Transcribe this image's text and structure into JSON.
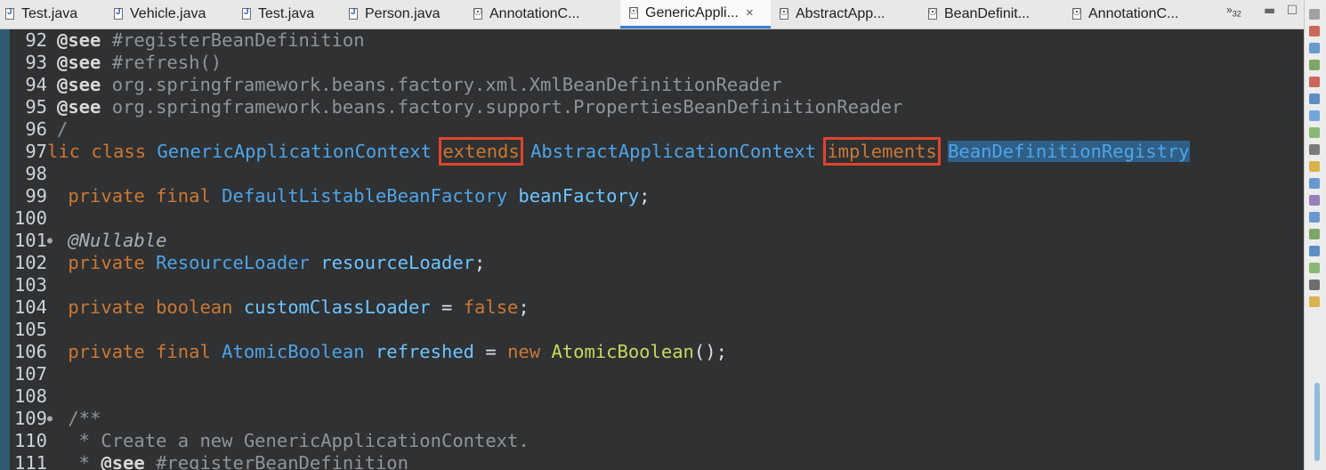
{
  "tabs": [
    {
      "label": "Test.java",
      "icon": "java-file-icon"
    },
    {
      "label": "Vehicle.java",
      "icon": "java-file-icon"
    },
    {
      "label": "Test.java",
      "icon": "java-file-icon"
    },
    {
      "label": "Person.java",
      "icon": "java-file-icon"
    },
    {
      "label": "AnnotationC...",
      "icon": "class-file-icon"
    },
    {
      "label": "GenericAppli...",
      "icon": "class-file-icon",
      "active": true
    },
    {
      "label": "AbstractApp...",
      "icon": "class-file-icon"
    },
    {
      "label": "BeanDefinit...",
      "icon": "class-file-icon"
    },
    {
      "label": "AnnotationC...",
      "icon": "class-file-icon"
    }
  ],
  "tab_close": "×",
  "overflow_count": "32",
  "window_controls": {
    "minimize": "☐",
    "maximize": "☐"
  },
  "editor": {
    "lines": [
      {
        "num": "92",
        "tokens": [
          [
            "d",
            "@see"
          ],
          [
            "c",
            " #registerBeanDefinition"
          ]
        ]
      },
      {
        "num": "93",
        "tokens": [
          [
            "d",
            "@see"
          ],
          [
            "c",
            " #refresh()"
          ]
        ]
      },
      {
        "num": "94",
        "tokens": [
          [
            "d",
            "@see"
          ],
          [
            "c",
            " org.springframework.beans.factory.xml.XmlBeanDefinitionReader"
          ]
        ]
      },
      {
        "num": "95",
        "tokens": [
          [
            "d",
            "@see"
          ],
          [
            "c",
            " org.springframework.beans.factory.support.PropertiesBeanDefinitionReader"
          ]
        ]
      },
      {
        "num": "96",
        "tokens": [
          [
            "c",
            "/"
          ]
        ]
      },
      {
        "num": "97",
        "tokens": [
          [
            "k",
            "lic class "
          ],
          [
            "t",
            "GenericApplicationContext"
          ],
          [
            "p",
            " "
          ],
          [
            "khl",
            "extends"
          ],
          [
            "p",
            " "
          ],
          [
            "t",
            "AbstractApplicationContext"
          ],
          [
            "p",
            " "
          ],
          [
            "khl",
            "implements"
          ],
          [
            "p",
            " "
          ],
          [
            "tsel",
            "BeanDefinitionRegistry"
          ]
        ]
      },
      {
        "num": "98",
        "tokens": []
      },
      {
        "num": "99",
        "tokens": [
          [
            "k",
            " private final "
          ],
          [
            "t",
            "DefaultListableBeanFactory"
          ],
          [
            "p",
            " "
          ],
          [
            "f",
            "beanFactory"
          ],
          [
            "p",
            ";"
          ]
        ]
      },
      {
        "num": "100",
        "tokens": []
      },
      {
        "num": "101",
        "fold": true,
        "tokens": [
          [
            "a",
            " @Nullable"
          ]
        ]
      },
      {
        "num": "102",
        "tokens": [
          [
            "k",
            " private "
          ],
          [
            "t",
            "ResourceLoader"
          ],
          [
            "p",
            " "
          ],
          [
            "f",
            "resourceLoader"
          ],
          [
            "p",
            ";"
          ]
        ]
      },
      {
        "num": "103",
        "tokens": []
      },
      {
        "num": "104",
        "tokens": [
          [
            "k",
            " private boolean "
          ],
          [
            "f",
            "customClassLoader"
          ],
          [
            "p",
            " = "
          ],
          [
            "k",
            "false"
          ],
          [
            "p",
            ";"
          ]
        ]
      },
      {
        "num": "105",
        "tokens": []
      },
      {
        "num": "106",
        "tokens": [
          [
            "k",
            " private final "
          ],
          [
            "t",
            "AtomicBoolean"
          ],
          [
            "p",
            " "
          ],
          [
            "f",
            "refreshed"
          ],
          [
            "p",
            " = "
          ],
          [
            "k",
            "new "
          ],
          [
            "m",
            "AtomicBoolean"
          ],
          [
            "p",
            "();"
          ]
        ]
      },
      {
        "num": "107",
        "tokens": []
      },
      {
        "num": "108",
        "tokens": []
      },
      {
        "num": "109",
        "fold": true,
        "tokens": [
          [
            "c",
            " /**"
          ]
        ]
      },
      {
        "num": "110",
        "tokens": [
          [
            "c",
            "  * Create a new GenericApplicationContext."
          ]
        ]
      },
      {
        "num": "111",
        "tokens": [
          [
            "c",
            "  * "
          ],
          [
            "d",
            "@see"
          ],
          [
            "c",
            " #registerBeanDefinition"
          ]
        ]
      }
    ]
  },
  "colors": {
    "editor_bg": "#2f3133",
    "keyword": "#cc7832",
    "type": "#4fa4e8",
    "field": "#6ec4ff",
    "method": "#c9d85d",
    "comment": "#8e959b",
    "highlight_box": "#e0442c",
    "selection": "#2f5f86",
    "active_tab_underline": "#3a7bd5"
  },
  "right_trim_icons": [
    "restore-icon",
    "bookmark-icon",
    "tasks-icon",
    "hierarchy-icon",
    "junit-icon",
    "console-icon",
    "outline-icon",
    "problems-icon",
    "search-icon",
    "javadoc-icon",
    "declaration-icon",
    "git-icon",
    "progress-icon",
    "type-hierarchy-icon",
    "call-hierarchy-icon",
    "history-icon",
    "breakpoints-icon",
    "properties-icon"
  ]
}
